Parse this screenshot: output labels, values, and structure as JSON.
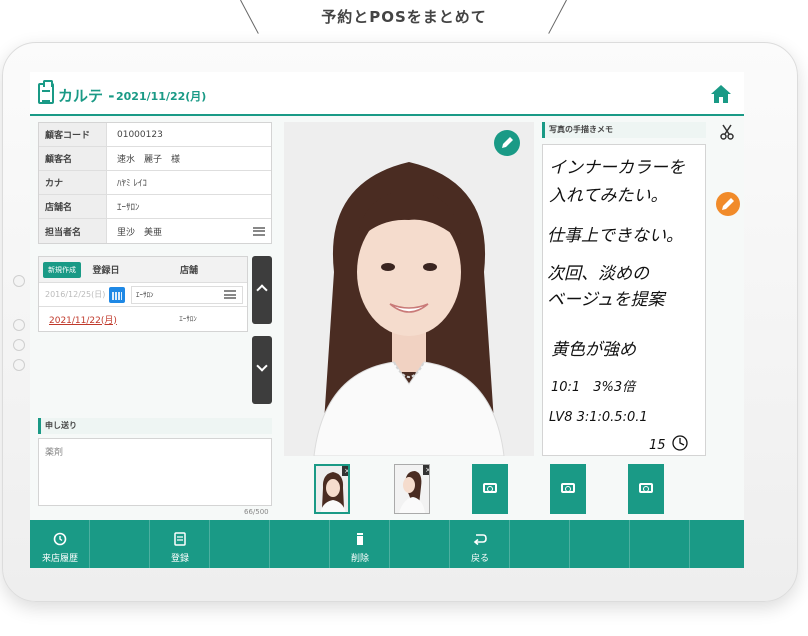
{
  "caption": "予約とPOSをまとめて",
  "header": {
    "title": "カルテ -",
    "date": "2021/11/22(月)"
  },
  "customer": {
    "rows": [
      {
        "label": "顧客コード",
        "value": "01000123"
      },
      {
        "label": "顧客名",
        "value": "速水　麗子　様"
      },
      {
        "label": "カナ",
        "value": "ﾊﾔﾐ ﾚｲｺ"
      },
      {
        "label": "店舗名",
        "value": "ｴｰｻﾛﾝ"
      },
      {
        "label": "担当者名",
        "value": "里沙　美亜"
      }
    ]
  },
  "visits": {
    "new_button": "新規作成",
    "col_date": "登録日",
    "col_shop": "店舗",
    "input_date": "2016/12/25(日)",
    "input_shop": "ｴｰｻﾛﾝ",
    "rows": [
      {
        "date": "2021/11/22(月)",
        "shop": "ｴｰｻﾛﾝ"
      }
    ]
  },
  "memo": {
    "label": "申し送り",
    "value": "薬剤",
    "count": "66/500"
  },
  "handwriting": {
    "label": "写真の手描きメモ",
    "lines": [
      "インナーカラーを",
      "入れてみたい。",
      "仕事上できない。",
      "次回、淡めの",
      "ベージュを提案",
      "黄色が強め",
      "10:1　3%3倍",
      "LV8 3:1:0.5:0.1",
      "15"
    ]
  },
  "footer": {
    "buttons": [
      {
        "label": "来店履歴",
        "icon": "history-icon"
      },
      {
        "label": "",
        "icon": ""
      },
      {
        "label": "登録",
        "icon": "register-icon"
      },
      {
        "label": "",
        "icon": ""
      },
      {
        "label": "",
        "icon": ""
      },
      {
        "label": "削除",
        "icon": "delete-icon"
      },
      {
        "label": "",
        "icon": ""
      },
      {
        "label": "戻る",
        "icon": "back-icon"
      },
      {
        "label": "",
        "icon": ""
      },
      {
        "label": "",
        "icon": ""
      },
      {
        "label": "",
        "icon": ""
      },
      {
        "label": "",
        "icon": ""
      }
    ]
  },
  "colors": {
    "accent": "#1a9a86",
    "orange": "#f18b2a",
    "date_red": "#c0392b"
  }
}
